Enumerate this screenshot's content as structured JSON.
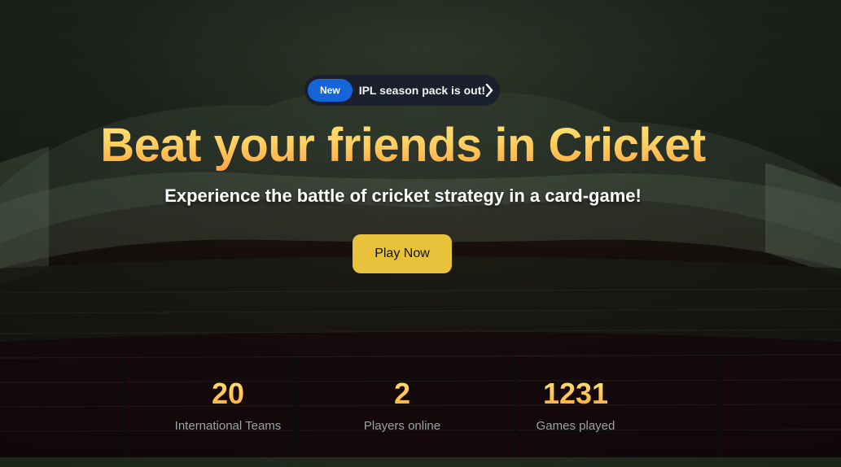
{
  "announcement": {
    "badge": "New",
    "text": "IPL season pack is out!",
    "icon": "chevron-right-icon"
  },
  "hero": {
    "title": "Beat your friends in Cricket",
    "subtitle": "Experience the battle of cricket strategy in a card-game!",
    "cta_label": "Play Now"
  },
  "stats": [
    {
      "value": "20",
      "label": "International Teams"
    },
    {
      "value": "2",
      "label": "Players online"
    },
    {
      "value": "1231",
      "label": "Games played"
    }
  ],
  "colors": {
    "accent_gold": "#e8c23a",
    "badge_blue": "#1565d8",
    "title_gradient_top": "#ffe77a",
    "title_gradient_bottom": "#ff9e3d"
  }
}
